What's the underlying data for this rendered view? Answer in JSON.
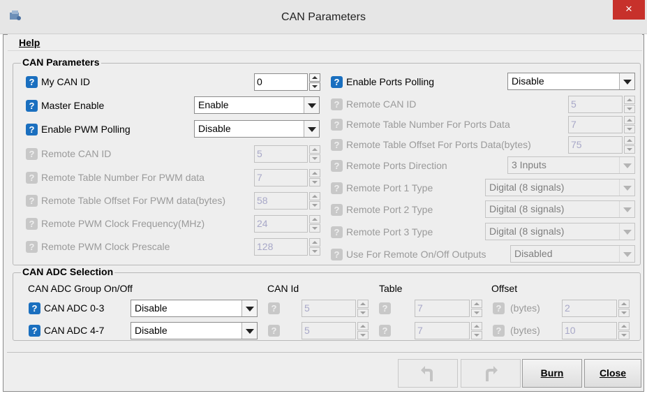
{
  "window": {
    "title": "CAN Parameters",
    "close_glyph": "×"
  },
  "menu": {
    "help": "Help"
  },
  "can_params": {
    "legend": "CAN Parameters",
    "help_glyph": "?",
    "my_can_id": {
      "label": "My CAN ID",
      "value": "0"
    },
    "master_enable": {
      "label": "Master Enable",
      "value": "Enable"
    },
    "enable_pwm_polling": {
      "label": "Enable PWM Polling",
      "value": "Disable"
    },
    "pwm_remote_can_id": {
      "label": "Remote CAN ID",
      "value": "5"
    },
    "pwm_remote_table": {
      "label": "Remote Table Number For PWM data",
      "value": "7"
    },
    "pwm_remote_offset": {
      "label": "Remote Table Offset For PWM data(bytes)",
      "value": "58"
    },
    "pwm_clock_freq": {
      "label": "Remote PWM Clock Frequency(MHz)",
      "value": "24"
    },
    "pwm_clock_prescale": {
      "label": "Remote PWM Clock Prescale",
      "value": "128"
    },
    "enable_ports_polling": {
      "label": "Enable Ports Polling",
      "value": "Disable"
    },
    "ports_remote_can_id": {
      "label": "Remote CAN ID",
      "value": "5"
    },
    "ports_remote_table": {
      "label": "Remote Table Number For Ports Data",
      "value": "7"
    },
    "ports_remote_offset": {
      "label": "Remote Table Offset For Ports Data(bytes)",
      "value": "75"
    },
    "ports_direction": {
      "label": "Remote Ports Direction",
      "value": "3 Inputs"
    },
    "port1_type": {
      "label": "Remote Port 1 Type",
      "value": "Digital (8 signals)"
    },
    "port2_type": {
      "label": "Remote Port 2 Type",
      "value": "Digital (8 signals)"
    },
    "port3_type": {
      "label": "Remote Port 3 Type",
      "value": "Digital (8 signals)"
    },
    "remote_onoff": {
      "label": "Use For Remote On/Off Outputs",
      "value": "Disabled"
    }
  },
  "adc": {
    "legend": "CAN ADC Selection",
    "headers": {
      "group": "CAN ADC Group On/Off",
      "can_id": "CAN Id",
      "table": "Table",
      "offset": "Offset"
    },
    "rows": [
      {
        "label": "CAN ADC 0-3",
        "onoff": "Disable",
        "can_id": "5",
        "table": "7",
        "bytes_label": "(bytes)",
        "offset": "2"
      },
      {
        "label": "CAN ADC 4-7",
        "onoff": "Disable",
        "can_id": "5",
        "table": "7",
        "bytes_label": "(bytes)",
        "offset": "10"
      }
    ]
  },
  "buttons": {
    "undo_icon": "undo-icon",
    "redo_icon": "redo-icon",
    "burn": "Burn",
    "close": "Close"
  },
  "colors": {
    "help_icon": "#1a6fbf",
    "close_button": "#c7312b",
    "panel": "#eeeeee"
  }
}
